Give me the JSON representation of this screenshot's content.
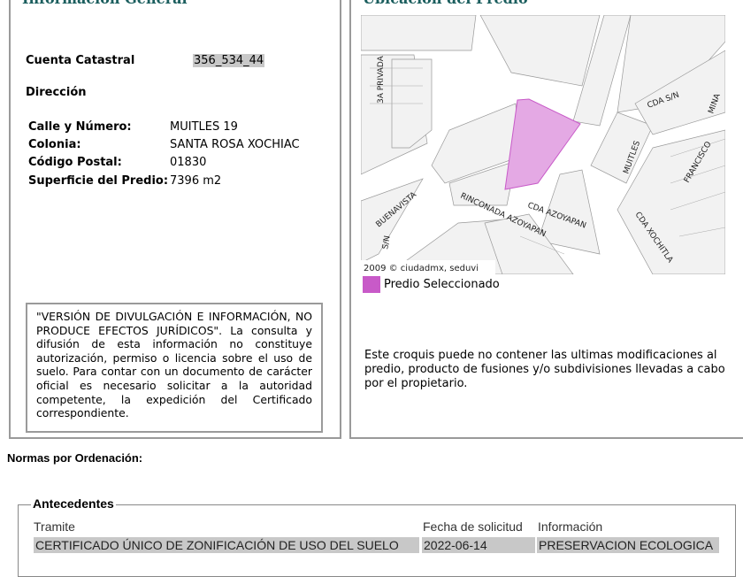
{
  "left": {
    "title": "Información General",
    "cuenta_label": "Cuenta Catastral",
    "cuenta_value": "356_534_44",
    "direccion_label": "Dirección",
    "fields": [
      {
        "label": "Calle y Número:",
        "value": "MUITLES 19"
      },
      {
        "label": "Colonia:",
        "value": "SANTA ROSA XOCHIAC"
      },
      {
        "label": "Código Postal:",
        "value": "01830"
      },
      {
        "label": "Superficie del Predio:",
        "value": "7396 m2"
      }
    ],
    "disclaimer": "\"VERSIÓN DE DIVULGACIÓN E INFORMACIÓN, NO PRODUCE EFECTOS JURÍDICOS\". La consulta y difusión de esta información no constituye autorización, permiso o licencia sobre el uso de suelo. Para contar con un documento de carácter oficial es necesario solicitar a la autoridad competente, la expedición del Certificado correspondiente."
  },
  "right": {
    "title": "Ubicación del Predio",
    "map_credit": "2009 © ciudadmx, seduvi",
    "legend": "Predio Seleccionado",
    "legend_color": "#c85ac8",
    "streets": [
      "3A PRIVADA",
      "CDA S/N",
      "MINA",
      "MUITLES",
      "FRANCISCO",
      "BUENAVISTA",
      "RINCONADA AZOYAPAN",
      "CDA AZOYAPAN",
      "CDA XOCHITLA",
      "S/N"
    ],
    "note": "Este croquis puede no contener las ultimas modificaciones al predio, producto de fusiones y/o subdivisiones llevadas a cabo por el propietario."
  },
  "normas_label": "Normas por Ordenación:",
  "antecedentes": {
    "title": "Antecedentes",
    "headers": [
      "Tramite",
      "Fecha de solicitud",
      "Información"
    ],
    "rows": [
      [
        "CERTIFICADO ÚNICO DE ZONIFICACIÓN DE USO DEL SUELO",
        "2022-06-14",
        "PRESERVACION ECOLOGICA"
      ]
    ]
  }
}
